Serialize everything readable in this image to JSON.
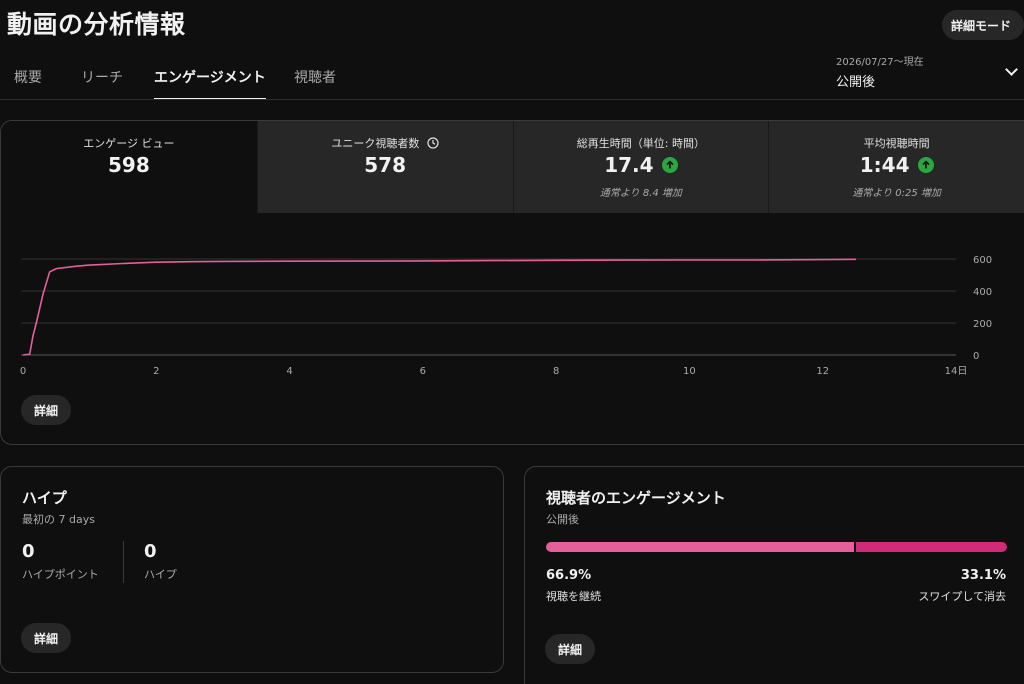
{
  "page": {
    "title": "動画の分析情報"
  },
  "header": {
    "detail_mode_label": "詳細モード"
  },
  "tabs": [
    {
      "label": "概要"
    },
    {
      "label": "リーチ"
    },
    {
      "label": "エンゲージメント"
    },
    {
      "label": "視聴者"
    }
  ],
  "date_selector": {
    "range": "2026/07/27～現在",
    "label": "公開後"
  },
  "metrics": [
    {
      "label": "エンゲージ ビュー",
      "value": "598",
      "note": ""
    },
    {
      "label": "ユニーク視聴者数",
      "value": "578",
      "note": ""
    },
    {
      "label": "総再生時間（単位: 時間）",
      "value": "17.4",
      "note": "通常より 8.4 増加"
    },
    {
      "label": "平均視聴時間",
      "value": "1:44",
      "note": "通常より 0:25 増加"
    }
  ],
  "colors": {
    "line": "#e5609a",
    "up_badge": "#2ba640",
    "engagement_continue": "#e5609a",
    "engagement_swipe": "#d12a78"
  },
  "chart_data": {
    "type": "line",
    "x_ticks": [
      "0",
      "2",
      "4",
      "6",
      "8",
      "10",
      "12",
      "14日"
    ],
    "y_ticks": [
      "0",
      "200",
      "400",
      "600"
    ],
    "xlim": [
      0,
      14
    ],
    "ylim": [
      0,
      600
    ],
    "grid": true,
    "series": [
      {
        "x": [
          0,
          0.1,
          0.15,
          0.2,
          0.3,
          0.4,
          0.5,
          0.8,
          1.0,
          1.5,
          2.0,
          2.5,
          3.0,
          4.0,
          5.0,
          6.0,
          7.0,
          8.0,
          9.0,
          10.0,
          11.0,
          12.0,
          12.5
        ],
        "y": [
          0,
          5,
          120,
          200,
          380,
          520,
          540,
          555,
          562,
          572,
          580,
          583,
          585,
          586,
          587,
          588,
          590,
          592,
          593,
          594,
          594,
          596,
          598
        ]
      }
    ]
  },
  "main_detail_label": "詳細",
  "hype": {
    "title": "ハイプ",
    "subtitle": "最初の 7 days",
    "points_value": "0",
    "points_label": "ハイプポイント",
    "hype_value": "0",
    "hype_label": "ハイプ",
    "detail_label": "詳細"
  },
  "engagement": {
    "title": "視聴者のエンゲージメント",
    "subtitle": "公開後",
    "continue_pct_value": 66.9,
    "continue_pct": "66.9%",
    "continue_label": "視聴を継続",
    "swipe_pct": "33.1%",
    "swipe_label": "スワイプして消去",
    "detail_label": "詳細"
  }
}
